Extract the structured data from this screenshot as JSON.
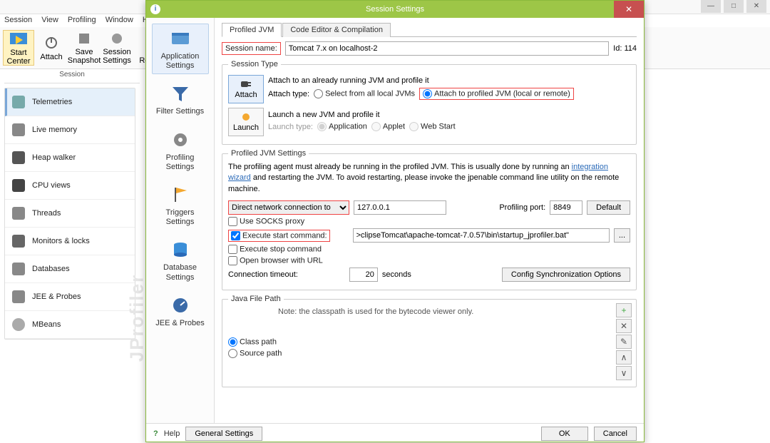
{
  "bg": {
    "menu": [
      "Session",
      "View",
      "Profiling",
      "Window",
      "He"
    ],
    "toolbar": [
      {
        "label": "Start\nCenter"
      },
      {
        "label": "Attach"
      },
      {
        "label": "Save\nSnapshot"
      },
      {
        "label": "Session\nSettings"
      },
      {
        "label": "St\nRecor"
      }
    ],
    "section": "Session",
    "nav": [
      "Telemetries",
      "Live memory",
      "Heap walker",
      "CPU views",
      "Threads",
      "Monitors & locks",
      "Databases",
      "JEE & Probes",
      "MBeans"
    ],
    "watermark": "JProfiler"
  },
  "dialog": {
    "title": "Session Settings",
    "left_icons": [
      "Application Settings",
      "Filter Settings",
      "Profiling Settings",
      "Triggers Settings",
      "Database Settings",
      "JEE & Probes"
    ],
    "tabs": [
      "Profiled JVM",
      "Code Editor & Compilation"
    ],
    "session_name_label": "Session name:",
    "session_name": "Tomcat 7.x on localhost-2",
    "id_label": "Id: 114",
    "session_type_legend": "Session Type",
    "attach_btn": "Attach",
    "attach_desc": "Attach to an already running JVM and profile it",
    "attach_type_label": "Attach type:",
    "attach_opt1": "Select from all local JVMs",
    "attach_opt2": "Attach to profiled JVM (local or remote)",
    "launch_btn": "Launch",
    "launch_desc": "Launch a new JVM and profile it",
    "launch_type_label": "Launch type:",
    "launch_opt1": "Application",
    "launch_opt2": "Applet",
    "launch_opt3": "Web Start",
    "pjs_legend": "Profiled JVM Settings",
    "pjs_text1": "The profiling agent must already be running in the profiled JVM. This is usually done by running an ",
    "pjs_link": "integration wizard",
    "pjs_text2": " and restarting the JVM. To avoid restarting, please invoke the jpenable command line utility on the remote machine.",
    "conn_type": "Direct network connection to",
    "host": "127.0.0.1",
    "port_label": "Profiling port:",
    "port": "8849",
    "default_btn": "Default",
    "chk_socks": "Use SOCKS proxy",
    "chk_start": "Execute start command:",
    "start_cmd": ">clipseTomcat\\apache-tomcat-7.0.57\\bin\\startup_jprofiler.bat\"",
    "chk_stop": "Execute stop command",
    "chk_browser": "Open browser with URL",
    "timeout_label": "Connection timeout:",
    "timeout": "20",
    "timeout_unit": "seconds",
    "sync_btn": "Config Synchronization Options",
    "jfp_legend": "Java File Path",
    "jfp_note": "Note: the classpath is used for the bytecode viewer only.",
    "jfp_opt1": "Class path",
    "jfp_opt2": "Source path",
    "help": "Help",
    "general": "General Settings",
    "ok": "OK",
    "cancel": "Cancel"
  }
}
